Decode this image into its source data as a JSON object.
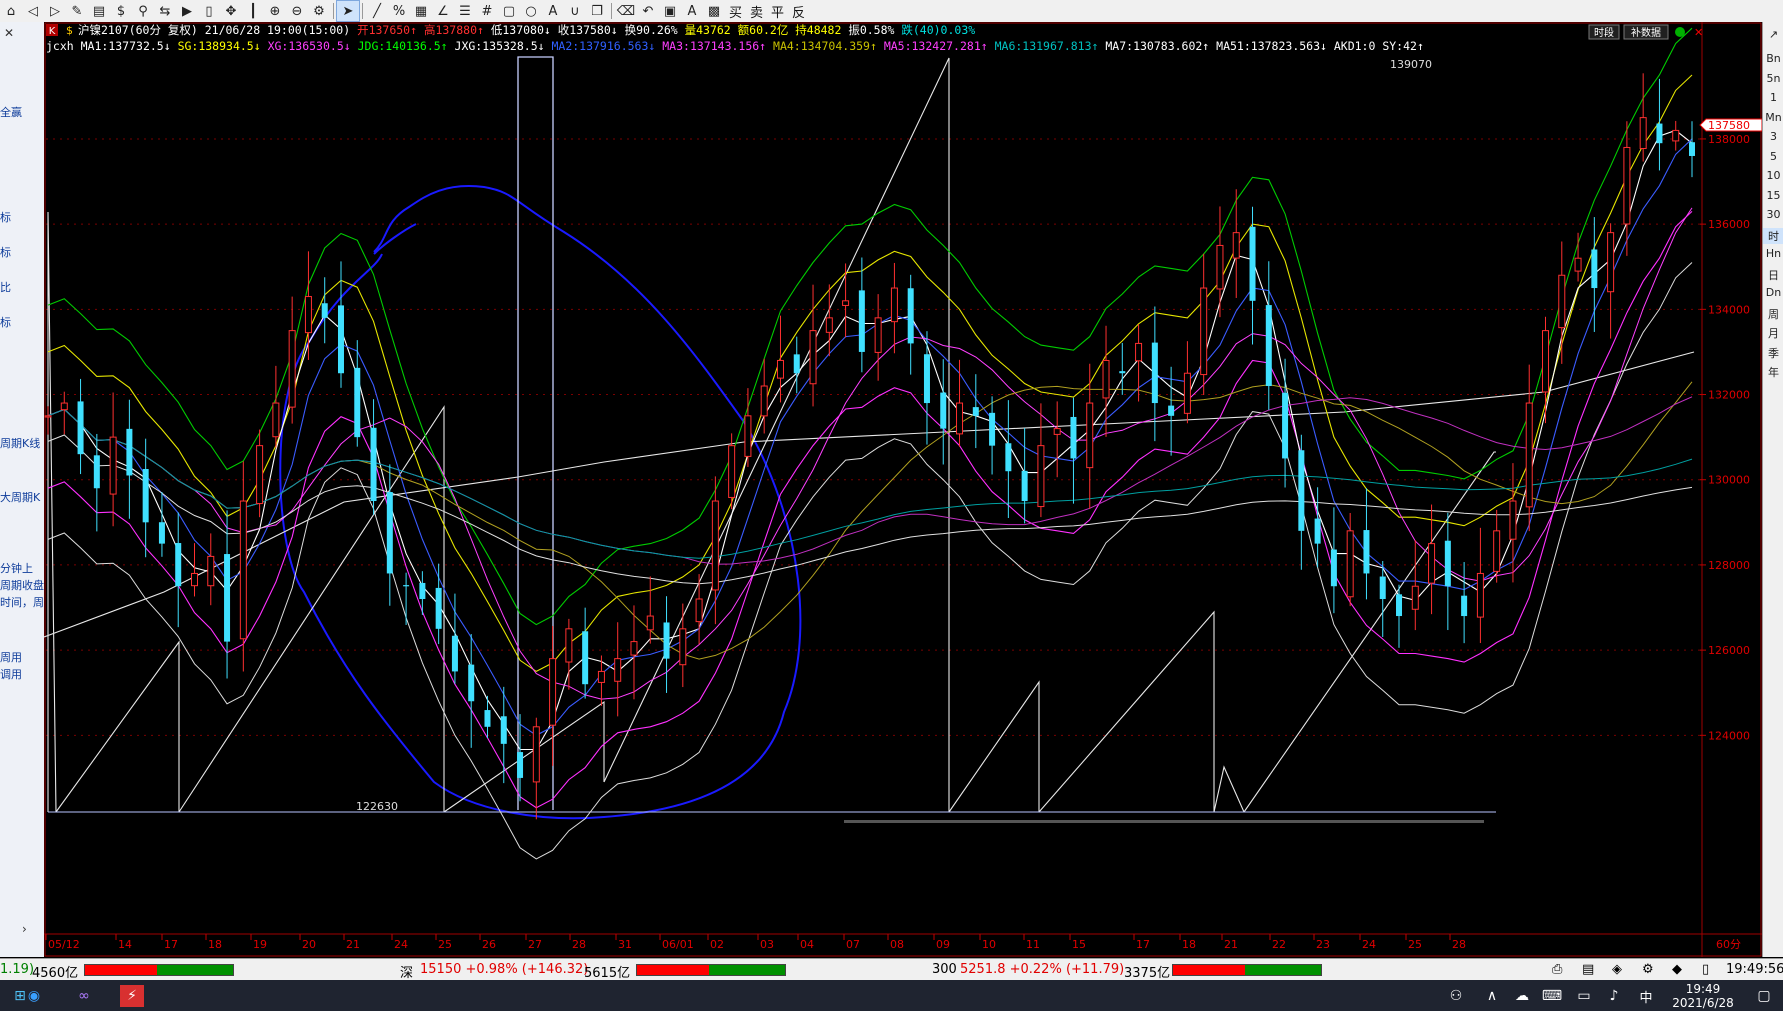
{
  "toolbar": {
    "icons": [
      "home",
      "back",
      "forward",
      "edit",
      "page",
      "dollar",
      "filter",
      "switch",
      "play",
      "doc",
      "move",
      "split",
      "zoom-in",
      "zoom-out",
      "gear",
      "cursor",
      "line",
      "percent",
      "grid",
      "angle",
      "list",
      "hash",
      "rect",
      "circle",
      "text",
      "magnet",
      "copy",
      "delete",
      "undo",
      "save",
      "font",
      "image"
    ],
    "menu": [
      "买",
      "卖",
      "平",
      "反"
    ]
  },
  "left_panel": {
    "labels": [
      "全赢",
      "标",
      "标",
      "比",
      "标",
      "周期K线",
      "大周期K",
      "分钟上",
      "周期收盘",
      "时间，周",
      "周用",
      "调用"
    ]
  },
  "right_panel": {
    "buttons": [
      "Bn",
      "5n",
      "1",
      "Mn",
      "3",
      "5",
      "10",
      "15",
      "30",
      "时",
      "Hn",
      "日",
      "Dn",
      "周",
      "月",
      "季",
      "年"
    ],
    "active": "时"
  },
  "header": {
    "k_badge": "K",
    "dollar": "$",
    "info": [
      {
        "text": "沪镍2107(60分 复权) 21/06/28 19:00(15:00)",
        "color": "#ffffff"
      },
      {
        "text": "开137650↑",
        "color": "#ff3030"
      },
      {
        "text": "高137880↑",
        "color": "#ff3030"
      },
      {
        "text": "低137080↓",
        "color": "#ffffff"
      },
      {
        "text": "收137580↓",
        "color": "#ffffff"
      },
      {
        "text": "换90.26%",
        "color": "#ffffff"
      },
      {
        "text": "量43762",
        "color": "#ffff00"
      },
      {
        "text": "额60.2亿",
        "color": "#ffff00"
      },
      {
        "text": "持48482",
        "color": "#ffff00"
      },
      {
        "text": "振0.58%",
        "color": "#ffffff"
      },
      {
        "text": "跌(40)0.03%",
        "color": "#00e0e0"
      }
    ],
    "buttons": [
      "时段",
      "补数据"
    ],
    "indicator": [
      {
        "text": "jcxh",
        "color": "#ffffff"
      },
      {
        "text": "MA1:137732.5↓",
        "color": "#ffffff"
      },
      {
        "text": "SG:138934.5↓",
        "color": "#ffff00"
      },
      {
        "text": "XG:136530.5↓",
        "color": "#ff40ff"
      },
      {
        "text": "JDG:140136.5↑",
        "color": "#00ff00"
      },
      {
        "text": "JXG:135328.5↓",
        "color": "#ffffff"
      },
      {
        "text": "MA2:137916.563↓",
        "color": "#3060ff"
      },
      {
        "text": "MA3:137143.156↑",
        "color": "#ff40ff"
      },
      {
        "text": "MA4:134704.359↑",
        "color": "#c8c000"
      },
      {
        "text": "MA5:132427.281↑",
        "color": "#ff40ff"
      },
      {
        "text": "MA6:131967.813↑",
        "color": "#00c0c0"
      },
      {
        "text": "MA7:130783.602↑",
        "color": "#ffffff"
      },
      {
        "text": "MA51:137823.563↓",
        "color": "#ffffff"
      },
      {
        "text": "AKD1:0",
        "color": "#ffffff"
      },
      {
        "text": "SY:42↑",
        "color": "#ffffff"
      }
    ]
  },
  "chart_data": {
    "type": "candlestick",
    "price_labels": [
      "138000",
      "136000",
      "134000",
      "132000",
      "130000",
      "128000",
      "126000",
      "124000"
    ],
    "price_values": [
      138000,
      136000,
      134000,
      132000,
      130000,
      128000,
      126000,
      124000
    ],
    "ylim": [
      122200,
      139900
    ],
    "current_price": "137580",
    "high_label": "139070",
    "low_label": "122630",
    "date_labels": [
      "05/12",
      "14",
      "17",
      "18",
      "19",
      "20",
      "21",
      "24",
      "25",
      "26",
      "27",
      "28",
      "31",
      "06/01",
      "02",
      "03",
      "04",
      "07",
      "08",
      "09",
      "10",
      "11",
      "15",
      "17",
      "18",
      "21",
      "22",
      "23",
      "24",
      "25",
      "28"
    ],
    "period_label": "60分",
    "closes": [
      131500,
      131800,
      130600,
      129800,
      131000,
      130100,
      129000,
      128500,
      127500,
      127800,
      128200,
      126200,
      129500,
      130800,
      131800,
      133500,
      134300,
      133800,
      132500,
      131000,
      129500,
      127800,
      127500,
      127200,
      126500,
      125500,
      124800,
      124200,
      123800,
      123000,
      124200,
      125800,
      126500,
      125200,
      125500,
      125800,
      126200,
      126800,
      125800,
      126500,
      127200,
      129500,
      130800,
      131500,
      132200,
      132800,
      132500,
      133500,
      133800,
      134200,
      133000,
      133800,
      134500,
      133200,
      131800,
      131200,
      131800,
      131500,
      130800,
      130200,
      129500,
      130800,
      131200,
      130500,
      131800,
      132800,
      132500,
      133200,
      131800,
      131500,
      132500,
      134500,
      135500,
      135800,
      134200,
      132200,
      130500,
      128800,
      128500,
      127500,
      128800,
      127800,
      127200,
      126800,
      127500,
      128500,
      127500,
      126800,
      127800,
      128800,
      129500,
      131800,
      133500,
      134800,
      135200,
      134500,
      135800,
      137800,
      138500,
      137900,
      138200,
      137600
    ]
  },
  "status_bar": {
    "s1_prefix": "1.19)",
    "s1_amount": "4560亿",
    "s2_name": "深",
    "s2_value": "15150 +0.98% (+146.32)",
    "s2_amount": "5615亿",
    "s3_name": "300",
    "s3_value": "5251.8 +0.22% (+11.79)",
    "s3_amount": "3375亿",
    "clock": "19:49:56"
  },
  "taskbar": {
    "time": "19:49",
    "date": "2021/6/28",
    "ime": "中"
  }
}
